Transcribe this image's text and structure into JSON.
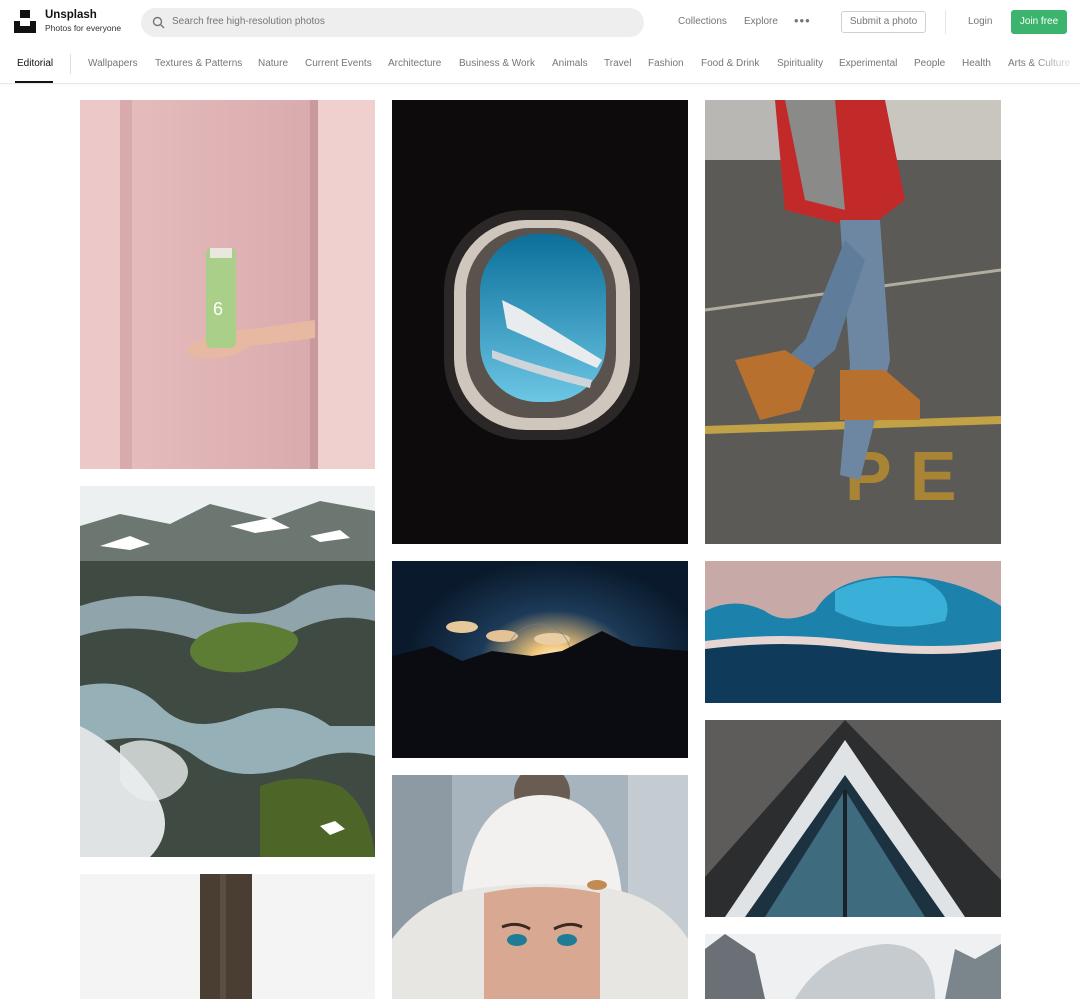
{
  "brand": {
    "name": "Unsplash",
    "tagline": "Photos for everyone"
  },
  "search": {
    "placeholder": "Search free high-resolution photos"
  },
  "nav": {
    "collections": "Collections",
    "explore": "Explore",
    "more": "•••",
    "submit": "Submit a photo",
    "login": "Login",
    "join": "Join free"
  },
  "topics": [
    "Editorial",
    "Wallpapers",
    "Textures & Patterns",
    "Nature",
    "Current Events",
    "Architecture",
    "Business & Work",
    "Animals",
    "Travel",
    "Fashion",
    "Food & Drink",
    "Spirituality",
    "Experimental",
    "People",
    "Health",
    "Arts & Culture"
  ],
  "photos": [
    {
      "subject": "hand-holding-green-bottle"
    },
    {
      "subject": "airplane-window-view"
    },
    {
      "subject": "walking-legs-boots"
    },
    {
      "subject": "aerial-river-landscape"
    },
    {
      "subject": "mountain-sunset-sky"
    },
    {
      "subject": "aerial-coastline-bay"
    },
    {
      "subject": "triangular-building"
    },
    {
      "subject": "bamboo-stalk"
    },
    {
      "subject": "woman-white-beanie"
    },
    {
      "subject": "snowy-scene"
    }
  ],
  "colors": {
    "accent": "#3cb46e",
    "text_muted": "#767676",
    "search_bg": "#eeeeee"
  }
}
